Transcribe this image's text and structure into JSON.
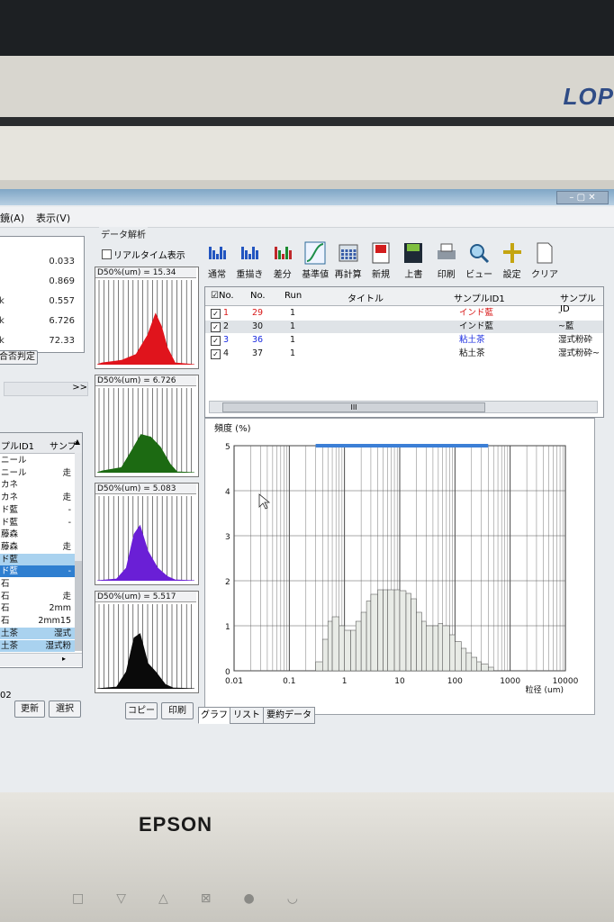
{
  "monitor": {
    "brand": "EPSON",
    "background_logo": "LOP"
  },
  "menu": {
    "items": [
      "鏡(A)",
      "表示(V)"
    ]
  },
  "left_panel": {
    "stats": [
      "0.033",
      "0.869",
      "0.557",
      "6.726",
      "72.33"
    ],
    "row_letters": [
      "k",
      "k",
      "k"
    ],
    "judge_button": "合否判定",
    "chevron": ">>",
    "sample_list": {
      "headers": [
        "プルID1",
        "サンプ"
      ],
      "rows": [
        [
          "ニール",
          ""
        ],
        [
          "ニール",
          "走"
        ],
        [
          "カネ",
          ""
        ],
        [
          "カネ",
          "走"
        ],
        [
          "ド藍",
          "-"
        ],
        [
          "ド藍",
          "-"
        ],
        [
          "藤森",
          ""
        ],
        [
          "藤森",
          "走"
        ],
        [
          "ド藍",
          ""
        ],
        [
          "ド藍",
          "-"
        ],
        [
          "石",
          ""
        ],
        [
          "石",
          "走"
        ],
        [
          "石",
          "2mm"
        ],
        [
          "石",
          "2mm15"
        ],
        [
          "土茶",
          "湿式"
        ],
        [
          "土茶",
          "湿式粉"
        ]
      ],
      "footer_num": "02"
    },
    "buttons": {
      "update": "更新",
      "select": "選択"
    }
  },
  "analysis": {
    "group_title": "データ解析",
    "realtime_label": "リアルタイム表示",
    "mini_charts": [
      {
        "label": "D50%(um) = 15.34",
        "color": "#e0141c"
      },
      {
        "label": "D50%(um) = 6.726",
        "color": "#1c6a12"
      },
      {
        "label": "D50%(um) = 5.083",
        "color": "#6a1fd6"
      },
      {
        "label": "D50%(um) = 5.517",
        "color": "#0a0a0a"
      }
    ],
    "buttons": {
      "copy": "コピー",
      "print": "印刷"
    }
  },
  "toolbar": [
    {
      "label": "通常",
      "icon": "normal-bars-icon"
    },
    {
      "label": "重描き",
      "icon": "overlay-bars-icon"
    },
    {
      "label": "差分",
      "icon": "difference-bars-icon"
    },
    {
      "label": "基準値",
      "icon": "reference-curve-icon"
    },
    {
      "label": "再計算",
      "icon": "calculator-icon"
    },
    {
      "label": "新規",
      "icon": "new-file-icon"
    },
    {
      "label": "上書",
      "icon": "save-disk-icon"
    },
    {
      "label": "印刷",
      "icon": "printer-icon"
    },
    {
      "label": "ビュー",
      "icon": "magnifier-view-icon"
    },
    {
      "label": "設定",
      "icon": "settings-cross-icon"
    },
    {
      "label": "クリア",
      "icon": "clear-page-icon"
    }
  ],
  "run_table": {
    "headers": [
      "☑No.",
      "No.",
      "Run",
      "タイトル",
      "サンプルID1",
      "サンプルID"
    ],
    "rows": [
      {
        "idx": "1",
        "no": "29",
        "run": "1",
        "title": "",
        "id1": "インド藍",
        "id2": "-",
        "color": "#d81818"
      },
      {
        "idx": "2",
        "no": "30",
        "run": "1",
        "title": "",
        "id1": "インド藍",
        "id2": "~藍",
        "color": "#111111"
      },
      {
        "idx": "3",
        "no": "36",
        "run": "1",
        "title": "",
        "id1": "粘土茶",
        "id2": "湿式粉砕",
        "color": "#1a2be0"
      },
      {
        "idx": "4",
        "no": "37",
        "run": "1",
        "title": "",
        "id1": "粘土茶",
        "id2": "湿式粉砕~",
        "color": "#111111"
      }
    ],
    "scroll_thumb": "III"
  },
  "tabs": [
    "グラフ",
    "リスト",
    "要約データ"
  ],
  "chart_data": {
    "type": "bar",
    "ylabel": "頻度 (%)",
    "xlabel": "粒径 (um)",
    "x_scale": "log",
    "xlim": [
      0.01,
      10000
    ],
    "ylim": [
      0,
      5
    ],
    "x_tick_labels": [
      "0.01",
      "0.1",
      "1",
      "10",
      "100",
      "1000",
      "10000"
    ],
    "y_tick_labels": [
      "0",
      "1",
      "2",
      "3",
      "4",
      "5"
    ],
    "grid": true,
    "x": [
      0.3,
      0.4,
      0.5,
      0.6,
      0.8,
      1,
      1.3,
      1.6,
      2,
      2.5,
      3,
      4,
      5,
      6,
      8,
      10,
      13,
      16,
      20,
      25,
      30,
      40,
      50,
      60,
      80,
      100,
      130,
      160,
      200,
      250,
      300,
      400
    ],
    "values": [
      0.2,
      0.7,
      1.1,
      1.2,
      1.0,
      0.9,
      0.9,
      1.1,
      1.3,
      1.55,
      1.7,
      1.8,
      1.8,
      1.8,
      1.8,
      1.78,
      1.72,
      1.6,
      1.3,
      1.1,
      1.0,
      1.0,
      1.05,
      1.0,
      0.8,
      0.65,
      0.5,
      0.4,
      0.3,
      0.2,
      0.15,
      0.08
    ]
  }
}
